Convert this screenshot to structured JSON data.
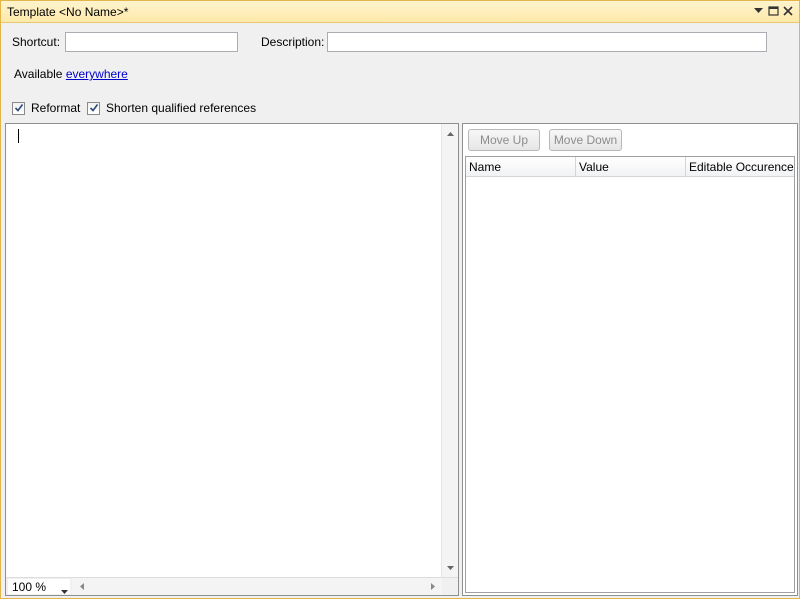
{
  "window": {
    "title": "Template <No Name>*"
  },
  "form": {
    "shortcut_label": "Shortcut:",
    "shortcut_value": "",
    "description_label": "Description:",
    "description_value": "",
    "available_prefix": "Available",
    "available_link": "everywhere"
  },
  "options": {
    "reformat_label": "Reformat",
    "reformat_checked": true,
    "shorten_label": "Shorten qualified references",
    "shorten_checked": true
  },
  "editor": {
    "zoom": "100 %"
  },
  "variables": {
    "move_up_label": "Move Up",
    "move_down_label": "Move Down",
    "columns": [
      "Name",
      "Value",
      "Editable Occurence"
    ]
  },
  "icons": {
    "dropdown": "chevron-down-icon",
    "restore": "restore-icon",
    "close": "close-icon"
  },
  "colors": {
    "title_bg": "#fde9a8",
    "link": "#0000cc",
    "window_bg": "#f0f0f0"
  }
}
